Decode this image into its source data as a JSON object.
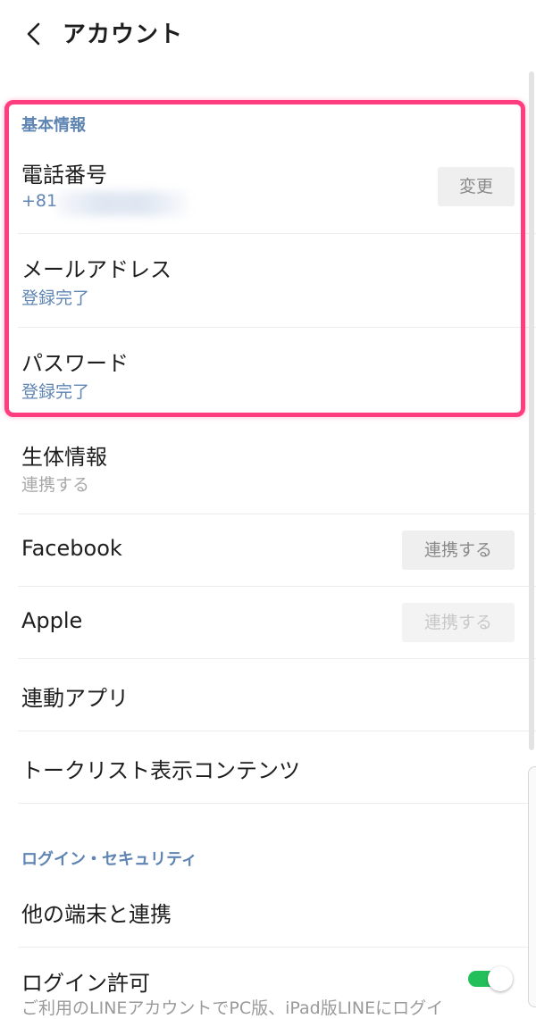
{
  "header": {
    "title": "アカウント",
    "back_icon": "chevron-left-icon"
  },
  "sections": {
    "basic": {
      "label": "基本情報"
    },
    "security": {
      "label": "ログイン・セキュリティ"
    }
  },
  "basic_items": {
    "phone": {
      "title": "電話番号",
      "value": "+81",
      "button": "変更"
    },
    "email": {
      "title": "メールアドレス",
      "status": "登録完了"
    },
    "password": {
      "title": "パスワード",
      "status": "登録完了"
    }
  },
  "items": {
    "biometric": {
      "title": "生体情報",
      "status": "連携する"
    },
    "facebook": {
      "title": "Facebook",
      "button": "連携する"
    },
    "apple": {
      "title": "Apple",
      "button": "連携する"
    },
    "linked_apps": {
      "title": "連動アプリ"
    },
    "talk_list": {
      "title": "トークリスト表示コンテンツ"
    }
  },
  "security_items": {
    "other_devices": {
      "title": "他の端末と連携"
    },
    "login_permission": {
      "title": "ログイン許可",
      "enabled": true,
      "description": "ご利用のLINEアカウントでPC版、iPad版LINEにログイ"
    }
  },
  "colors": {
    "accent": "#5f85b3",
    "highlight": "#ff3d7f",
    "toggle_on": "#22c05a"
  }
}
